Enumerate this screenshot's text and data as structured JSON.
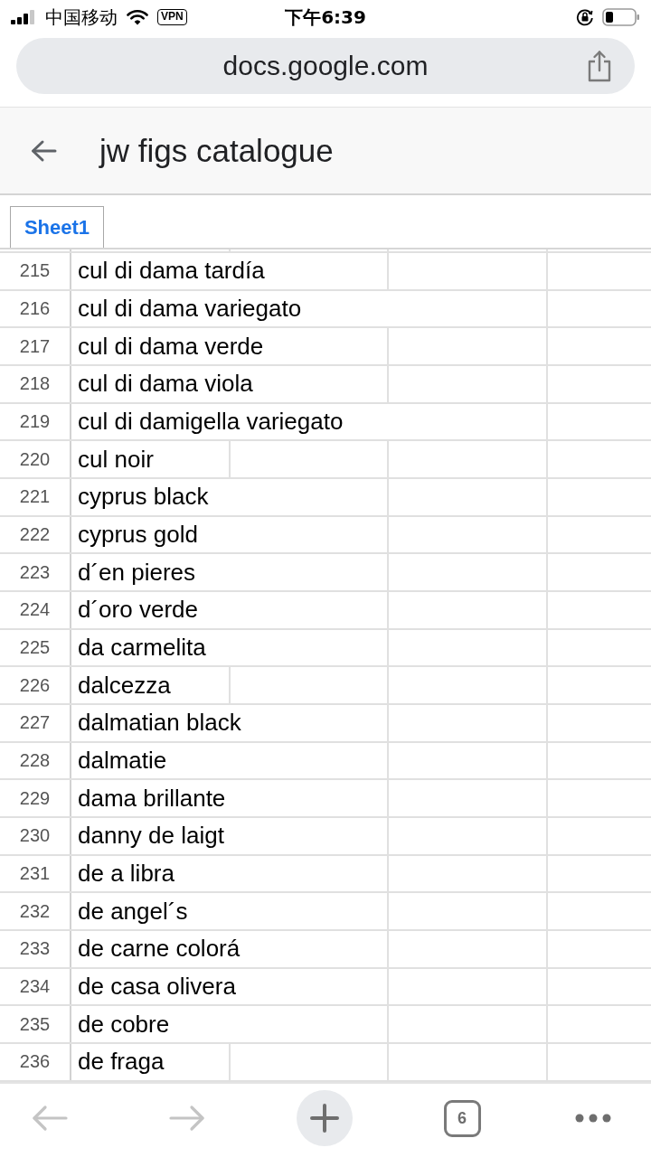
{
  "status_bar": {
    "carrier": "中国移动",
    "vpn": "VPN",
    "time": "下午6:39"
  },
  "address_bar": {
    "url": "docs.google.com"
  },
  "header": {
    "title": "jw figs catalogue"
  },
  "sheet_tabs": [
    {
      "label": "Sheet1",
      "selected": true
    }
  ],
  "sheet": {
    "rows": [
      {
        "number": "215",
        "value": "cul di dama tardía",
        "spills_into_column_2": true,
        "spills_into_column_3": false
      },
      {
        "number": "216",
        "value": "cul di dama variegato",
        "spills_into_column_2": true,
        "spills_into_column_3": true
      },
      {
        "number": "217",
        "value": "cul di dama verde",
        "spills_into_column_2": true,
        "spills_into_column_3": false
      },
      {
        "number": "218",
        "value": "cul di dama viola",
        "spills_into_column_2": true,
        "spills_into_column_3": false
      },
      {
        "number": "219",
        "value": "cul di damigella variegato",
        "spills_into_column_2": true,
        "spills_into_column_3": true
      },
      {
        "number": "220",
        "value": "cul noir",
        "spills_into_column_2": false,
        "spills_into_column_3": false
      },
      {
        "number": "221",
        "value": "cyprus black",
        "spills_into_column_2": true,
        "spills_into_column_3": false
      },
      {
        "number": "222",
        "value": "cyprus gold",
        "spills_into_column_2": true,
        "spills_into_column_3": false
      },
      {
        "number": "223",
        "value": "d´en pieres",
        "spills_into_column_2": true,
        "spills_into_column_3": false
      },
      {
        "number": "224",
        "value": "d´oro verde",
        "spills_into_column_2": true,
        "spills_into_column_3": false
      },
      {
        "number": "225",
        "value": "da carmelita",
        "spills_into_column_2": true,
        "spills_into_column_3": false
      },
      {
        "number": "226",
        "value": "dalcezza",
        "spills_into_column_2": false,
        "spills_into_column_3": false
      },
      {
        "number": "227",
        "value": "dalmatian black",
        "spills_into_column_2": true,
        "spills_into_column_3": false
      },
      {
        "number": "228",
        "value": "dalmatie",
        "spills_into_column_2": true,
        "spills_into_column_3": false
      },
      {
        "number": "229",
        "value": "dama brillante",
        "spills_into_column_2": true,
        "spills_into_column_3": false
      },
      {
        "number": "230",
        "value": "danny de laigt",
        "spills_into_column_2": true,
        "spills_into_column_3": false
      },
      {
        "number": "231",
        "value": "de a libra",
        "spills_into_column_2": true,
        "spills_into_column_3": false
      },
      {
        "number": "232",
        "value": "de angel´s",
        "spills_into_column_2": true,
        "spills_into_column_3": false
      },
      {
        "number": "233",
        "value": "de carne colorá",
        "spills_into_column_2": true,
        "spills_into_column_3": false
      },
      {
        "number": "234",
        "value": "de casa olivera",
        "spills_into_column_2": true,
        "spills_into_column_3": false
      },
      {
        "number": "235",
        "value": "de cobre",
        "spills_into_column_2": true,
        "spills_into_column_3": false
      },
      {
        "number": "236",
        "value": "de fraga",
        "spills_into_column_2": false,
        "spills_into_column_3": false
      }
    ]
  },
  "toolbar": {
    "back": {
      "disabled": true
    },
    "forward": {
      "disabled": true
    },
    "tab_count": "6"
  }
}
